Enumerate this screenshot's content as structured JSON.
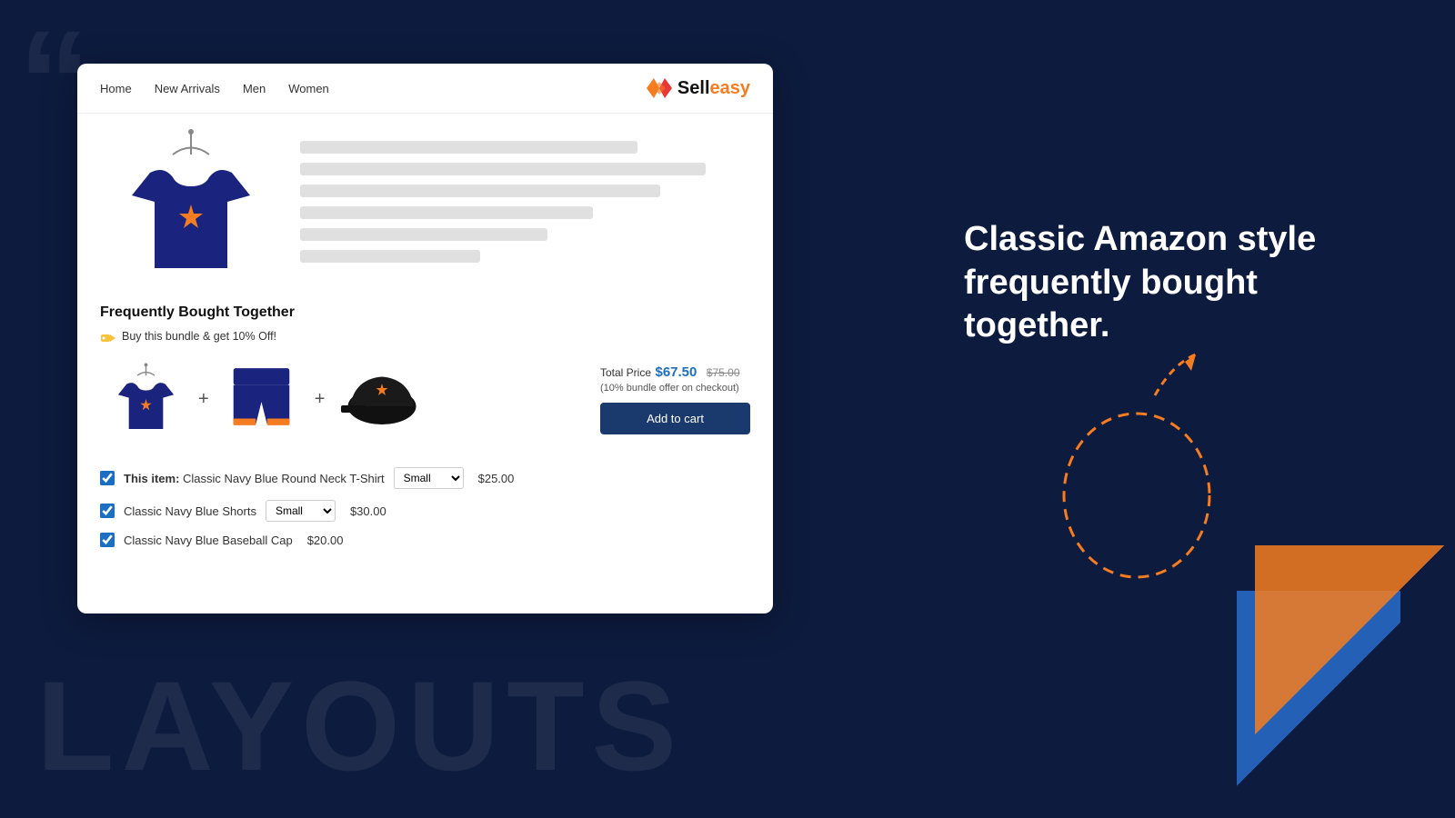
{
  "background": {
    "quote_char": "“",
    "layouts_text": "LAYOUTS"
  },
  "nav": {
    "links": [
      "Home",
      "New Arrivals",
      "Men",
      "Women"
    ],
    "logo_sell": "Sell",
    "logo_easy": "easy"
  },
  "product": {
    "skeleton_widths": [
      "75%",
      "90%",
      "80%",
      "65%",
      "55%",
      "40%"
    ]
  },
  "fbt": {
    "title": "Frequently Bought Together",
    "subtitle": "Buy this bundle & get 10% Off!",
    "total_label": "Total Price",
    "price_new": "$67.50",
    "price_old": "$75.00",
    "discount_note": "(10% bundle offer on checkout)",
    "add_btn": "Add to cart",
    "items": [
      {
        "checked": true,
        "label_prefix": "This item:",
        "name": "Classic Navy Blue Round Neck T-Shirt",
        "size": "Small",
        "price": "$25.00",
        "has_size": true
      },
      {
        "checked": true,
        "label_prefix": "",
        "name": "Classic Navy Blue Shorts",
        "size": "Small",
        "price": "$30.00",
        "has_size": true
      },
      {
        "checked": true,
        "label_prefix": "",
        "name": "Classic Navy Blue Baseball Cap",
        "size": "",
        "price": "$20.00",
        "has_size": false
      }
    ]
  },
  "right": {
    "heading": "Classic Amazon style frequently bought together."
  }
}
